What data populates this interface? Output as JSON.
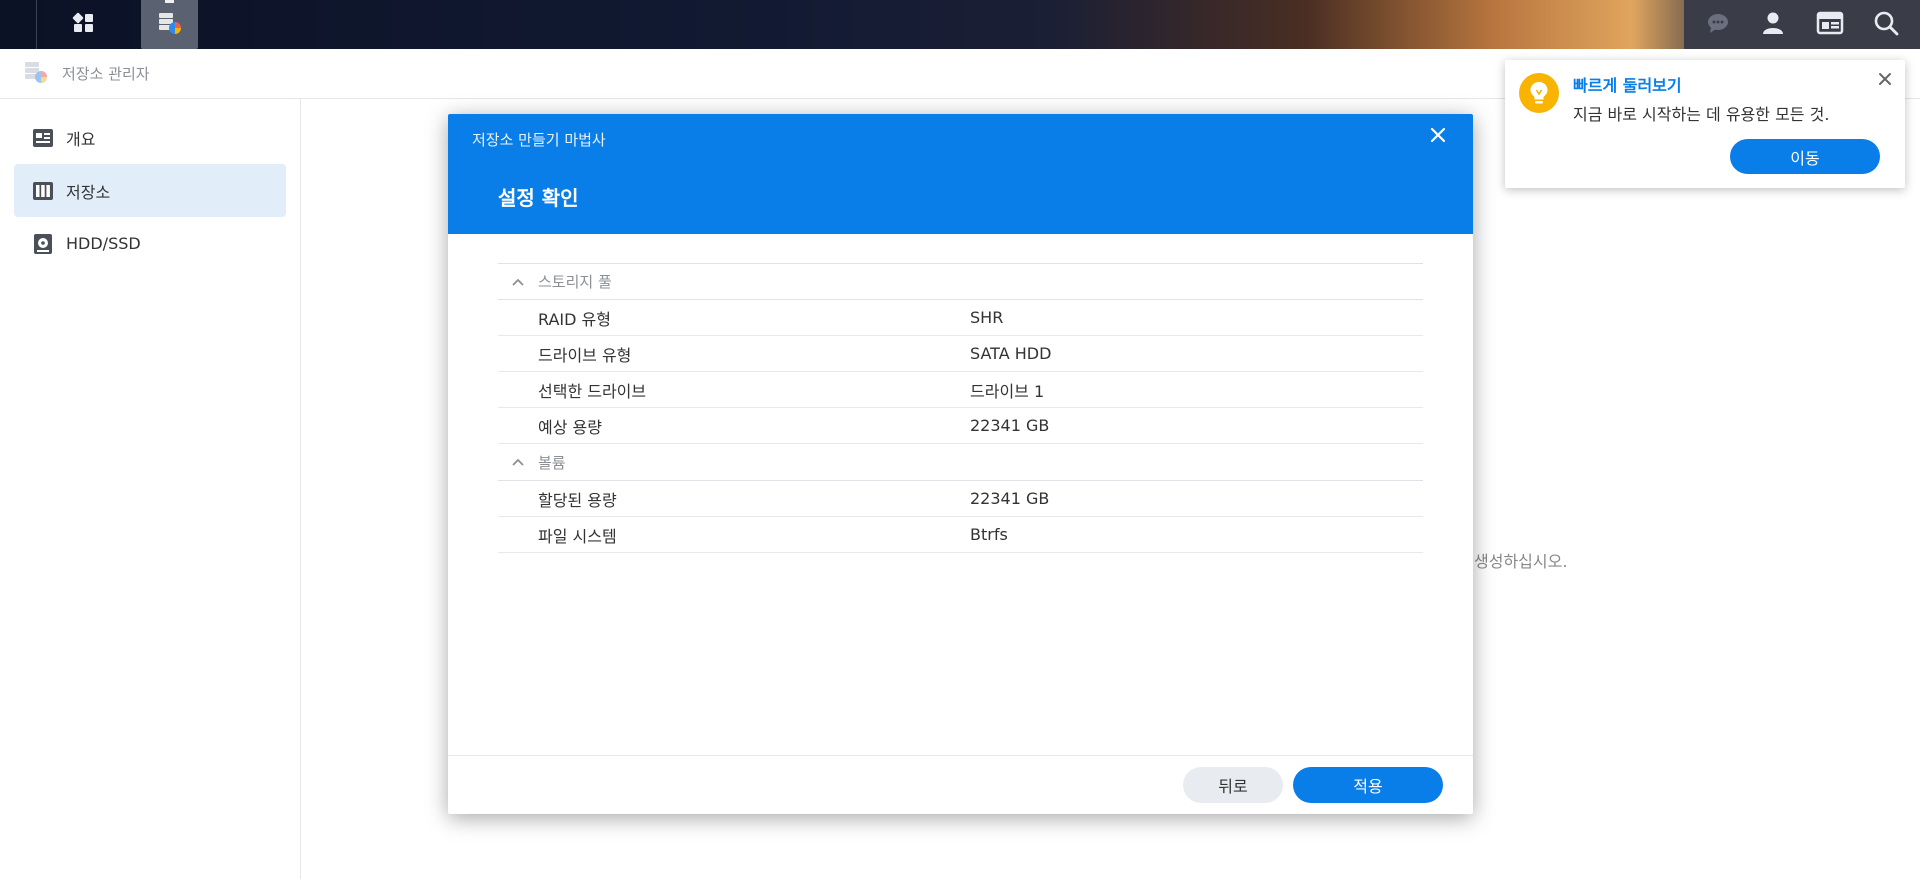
{
  "taskbar": {
    "home_icon": "grid-icon",
    "app_icon": "storage-manager-icon",
    "right_icons": [
      "chat-icon",
      "user-icon",
      "widgets-icon",
      "search-icon"
    ]
  },
  "window": {
    "title": "저장소 관리자",
    "icon": "storage-manager-icon"
  },
  "sidebar": {
    "items": [
      {
        "label": "개요",
        "icon": "overview-icon",
        "active": false
      },
      {
        "label": "저장소",
        "icon": "storage-icon",
        "active": true
      },
      {
        "label": "HDD/SSD",
        "icon": "hdd-icon",
        "active": false
      }
    ]
  },
  "background_hint": "생성하십시오.",
  "modal": {
    "wizard_title": "저장소 만들기 마법사",
    "step_title": "설정 확인",
    "sections": [
      {
        "title": "스토리지 풀",
        "rows": [
          {
            "key": "RAID 유형",
            "value": "SHR"
          },
          {
            "key": "드라이브 유형",
            "value": "SATA HDD"
          },
          {
            "key": "선택한 드라이브",
            "value": "드라이브 1"
          },
          {
            "key": "예상 용량",
            "value": "22341 GB"
          }
        ]
      },
      {
        "title": "볼륨",
        "rows": [
          {
            "key": "할당된 용량",
            "value": "22341 GB"
          },
          {
            "key": "파일 시스템",
            "value": "Btrfs"
          }
        ]
      }
    ],
    "back_label": "뒤로",
    "apply_label": "적용"
  },
  "toast": {
    "title": "빠르게 둘러보기",
    "body": "지금 바로 시작하는 데 유용한 모든 것.",
    "button_label": "이동"
  },
  "colors": {
    "accent": "#0a7ee8",
    "sidebar_active": "#e2edfa",
    "bulb": "#f8b400"
  }
}
